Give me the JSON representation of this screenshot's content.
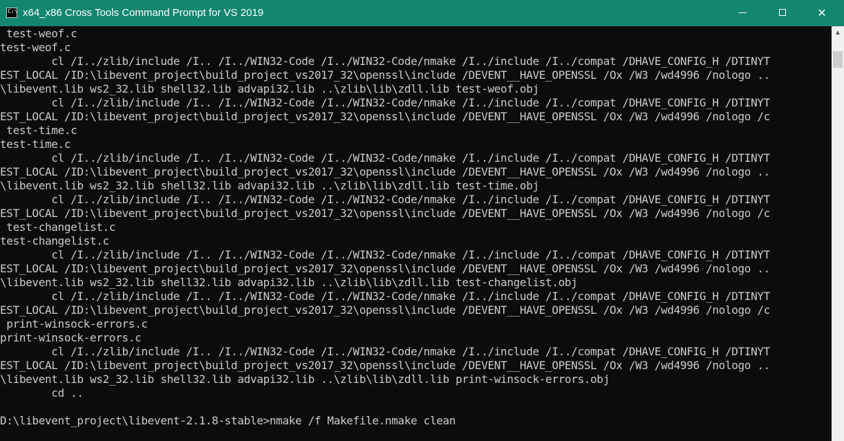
{
  "window": {
    "title": "x64_x86 Cross Tools Command Prompt for VS 2019",
    "app_icon_glyph": "C:\\",
    "minimize_icon": "minimize-icon",
    "maximize_icon": "maximize-icon",
    "close_glyph": "✕",
    "scroll_up_glyph": "▲"
  },
  "colors": {
    "titlebar": "#13866f",
    "console_bg": "#0c0c0c",
    "console_text": "#cccccc",
    "scrollbar_track": "#f0f0f0",
    "scrollbar_thumb": "#cdcdcd"
  },
  "console": {
    "lines": [
      " test-weof.c",
      "test-weof.c",
      "        cl /I../zlib/include /I.. /I../WIN32-Code /I../WIN32-Code/nmake /I../include /I../compat /DHAVE_CONFIG_H /DTINYT",
      "EST_LOCAL /ID:\\libevent_project\\build_project_vs2017_32\\openssl\\include /DEVENT__HAVE_OPENSSL /Ox /W3 /wd4996 /nologo ..",
      "\\libevent.lib ws2_32.lib shell32.lib advapi32.lib ..\\zlib\\lib\\zdll.lib test-weof.obj",
      "        cl /I../zlib/include /I.. /I../WIN32-Code /I../WIN32-Code/nmake /I../include /I../compat /DHAVE_CONFIG_H /DTINYT",
      "EST_LOCAL /ID:\\libevent_project\\build_project_vs2017_32\\openssl\\include /DEVENT__HAVE_OPENSSL /Ox /W3 /wd4996 /nologo /c",
      " test-time.c",
      "test-time.c",
      "        cl /I../zlib/include /I.. /I../WIN32-Code /I../WIN32-Code/nmake /I../include /I../compat /DHAVE_CONFIG_H /DTINYT",
      "EST_LOCAL /ID:\\libevent_project\\build_project_vs2017_32\\openssl\\include /DEVENT__HAVE_OPENSSL /Ox /W3 /wd4996 /nologo ..",
      "\\libevent.lib ws2_32.lib shell32.lib advapi32.lib ..\\zlib\\lib\\zdll.lib test-time.obj",
      "        cl /I../zlib/include /I.. /I../WIN32-Code /I../WIN32-Code/nmake /I../include /I../compat /DHAVE_CONFIG_H /DTINYT",
      "EST_LOCAL /ID:\\libevent_project\\build_project_vs2017_32\\openssl\\include /DEVENT__HAVE_OPENSSL /Ox /W3 /wd4996 /nologo /c",
      " test-changelist.c",
      "test-changelist.c",
      "        cl /I../zlib/include /I.. /I../WIN32-Code /I../WIN32-Code/nmake /I../include /I../compat /DHAVE_CONFIG_H /DTINYT",
      "EST_LOCAL /ID:\\libevent_project\\build_project_vs2017_32\\openssl\\include /DEVENT__HAVE_OPENSSL /Ox /W3 /wd4996 /nologo ..",
      "\\libevent.lib ws2_32.lib shell32.lib advapi32.lib ..\\zlib\\lib\\zdll.lib test-changelist.obj",
      "        cl /I../zlib/include /I.. /I../WIN32-Code /I../WIN32-Code/nmake /I../include /I../compat /DHAVE_CONFIG_H /DTINYT",
      "EST_LOCAL /ID:\\libevent_project\\build_project_vs2017_32\\openssl\\include /DEVENT__HAVE_OPENSSL /Ox /W3 /wd4996 /nologo /c",
      " print-winsock-errors.c",
      "print-winsock-errors.c",
      "        cl /I../zlib/include /I.. /I../WIN32-Code /I../WIN32-Code/nmake /I../include /I../compat /DHAVE_CONFIG_H /DTINYT",
      "EST_LOCAL /ID:\\libevent_project\\build_project_vs2017_32\\openssl\\include /DEVENT__HAVE_OPENSSL /Ox /W3 /wd4996 /nologo ..",
      "\\libevent.lib ws2_32.lib shell32.lib advapi32.lib ..\\zlib\\lib\\zdll.lib print-winsock-errors.obj",
      "        cd ..",
      "",
      "D:\\libevent_project\\libevent-2.1.8-stable>nmake /f Makefile.nmake clean"
    ]
  }
}
